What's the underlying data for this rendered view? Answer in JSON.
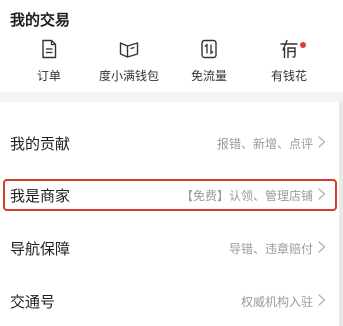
{
  "section": {
    "title": "我的交易"
  },
  "trade_items": [
    {
      "label": "订单",
      "icon": "order-document-icon"
    },
    {
      "label": "度小满钱包",
      "icon": "wallet-icon"
    },
    {
      "label": "免流量",
      "icon": "data-free-icon"
    },
    {
      "label": "有钱花",
      "icon": "loan-icon",
      "badge": "red-dot"
    }
  ],
  "rows": [
    {
      "title": "我的贡献",
      "subtitle": "报错、新增、点评"
    },
    {
      "title": "我是商家",
      "subtitle": "【免费】认领、管理店铺"
    },
    {
      "title": "导航保障",
      "subtitle": "导错、违章赔付"
    },
    {
      "title": "交通号",
      "subtitle": "权威机构入驻"
    }
  ],
  "colors": {
    "highlight_border": "#d83a2c",
    "badge": "#e53935",
    "subtitle": "#9a9a9a"
  }
}
